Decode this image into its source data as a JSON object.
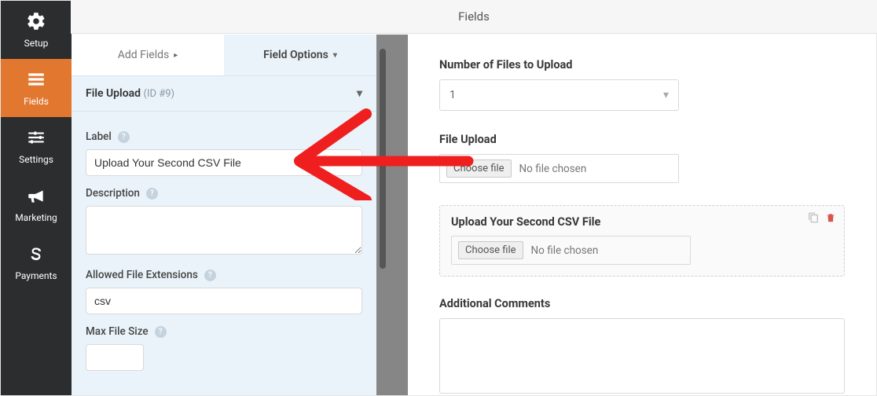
{
  "header": {
    "title": "Fields"
  },
  "sidebar": {
    "items": [
      {
        "label": "Setup"
      },
      {
        "label": "Fields"
      },
      {
        "label": "Settings"
      },
      {
        "label": "Marketing"
      },
      {
        "label": "Payments"
      }
    ]
  },
  "panel": {
    "tabs": {
      "add_fields": "Add Fields",
      "field_options": "Field Options"
    },
    "section": {
      "title": "File Upload",
      "id_label": "(ID #9)"
    },
    "labels": {
      "label": "Label",
      "description": "Description",
      "allowed_ext": "Allowed File Extensions",
      "max_filesize": "Max File Size"
    },
    "values": {
      "label": "Upload Your Second CSV File",
      "description": "",
      "allowed_ext": "csv",
      "max_filesize": ""
    }
  },
  "preview": {
    "num_files": {
      "label": "Number of Files to Upload",
      "value": "1"
    },
    "upload1": {
      "label": "File Upload",
      "choose": "Choose file",
      "placeholder": "No file chosen"
    },
    "upload2": {
      "label": "Upload Your Second CSV File",
      "choose": "Choose file",
      "placeholder": "No file chosen"
    },
    "comments": {
      "label": "Additional Comments"
    }
  }
}
